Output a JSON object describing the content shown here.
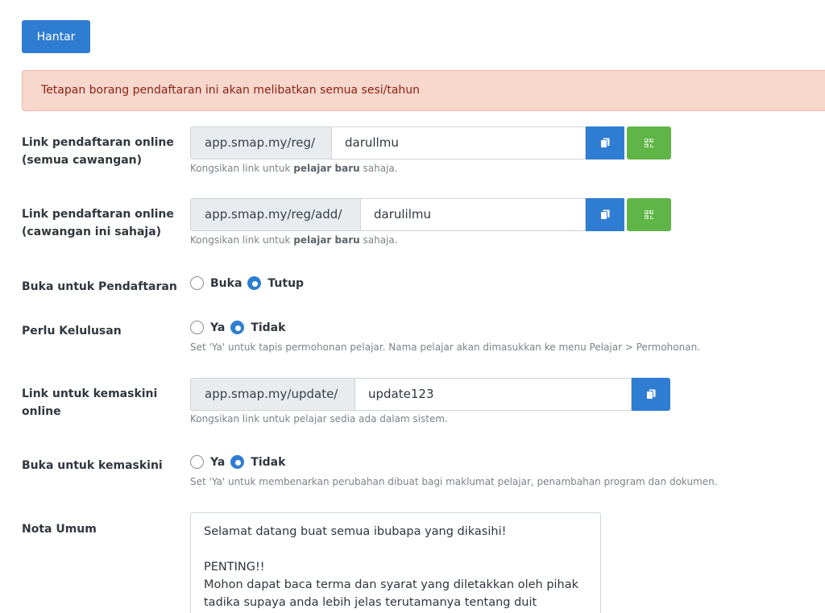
{
  "toolbar": {
    "submit_label": "Hantar"
  },
  "alert": {
    "message": "Tetapan borang pendaftaran ini akan melibatkan semua sesi/tahun"
  },
  "colors": {
    "primary": "#2f7dd2",
    "success": "#5fb546",
    "alert_bg": "#f8d7cd",
    "alert_text": "#8a2313"
  },
  "reg_all": {
    "label_line1": "Link pendaftaran online",
    "label_line2": "(semua cawangan)",
    "prefix": "app.smap.my/reg/",
    "value": "darullmu",
    "help_before": "Kongsikan link untuk ",
    "help_bold": "pelajar baru",
    "help_after": " sahaja.",
    "copy_icon": "copy-icon",
    "qr_icon": "qr-code-icon"
  },
  "reg_branch": {
    "label_line1": "Link pendaftaran online",
    "label_line2": "(cawangan ini sahaja)",
    "prefix": "app.smap.my/reg/add/",
    "value": "darulilmu",
    "help_before": "Kongsikan link untuk ",
    "help_bold": "pelajar baru",
    "help_after": " sahaja.",
    "copy_icon": "copy-icon",
    "qr_icon": "qr-code-icon"
  },
  "open_registration": {
    "label": "Buka untuk Pendaftaran",
    "option_yes": "Buka",
    "option_no": "Tutup",
    "selected": "Tutup"
  },
  "approval": {
    "label": "Perlu Kelulusan",
    "option_yes": "Ya",
    "option_no": "Tidak",
    "selected": "Tidak",
    "help": "Set 'Ya' untuk tapis permohonan pelajar. Nama pelajar akan dimasukkan ke menu Pelajar > Permohonan."
  },
  "update_link": {
    "label_line1": "Link untuk kemaskini",
    "label_line2": "online",
    "prefix": "app.smap.my/update/",
    "value": "update123",
    "help": "Kongsikan link untuk pelajar sedia ada dalam sistem.",
    "copy_icon": "copy-icon"
  },
  "open_update": {
    "label": "Buka untuk kemaskini",
    "option_yes": "Ya",
    "option_no": "Tidak",
    "selected": "Tidak",
    "help": "Set 'Ya' untuk membenarkan perubahan dibuat bagi maklumat pelajar, penambahan program dan dokumen."
  },
  "notes": {
    "label": "Nota Umum",
    "value": "Selamat datang buat semua ibubapa yang dikasihi!\n\nPENTING!!\nMohon dapat baca terma dan syarat yang diletakkan oleh pihak tadika supaya anda lebih jelas terutamanya tentang duit"
  }
}
